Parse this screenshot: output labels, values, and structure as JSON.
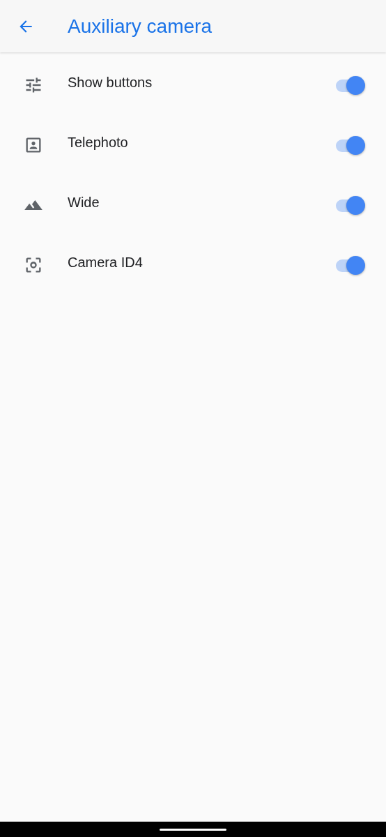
{
  "app_bar": {
    "title": "Auxiliary camera"
  },
  "settings": [
    {
      "label": "Show buttons",
      "on": true
    },
    {
      "label": "Telephoto",
      "on": true
    },
    {
      "label": "Wide",
      "on": true
    },
    {
      "label": "Camera ID4",
      "on": true
    }
  ]
}
